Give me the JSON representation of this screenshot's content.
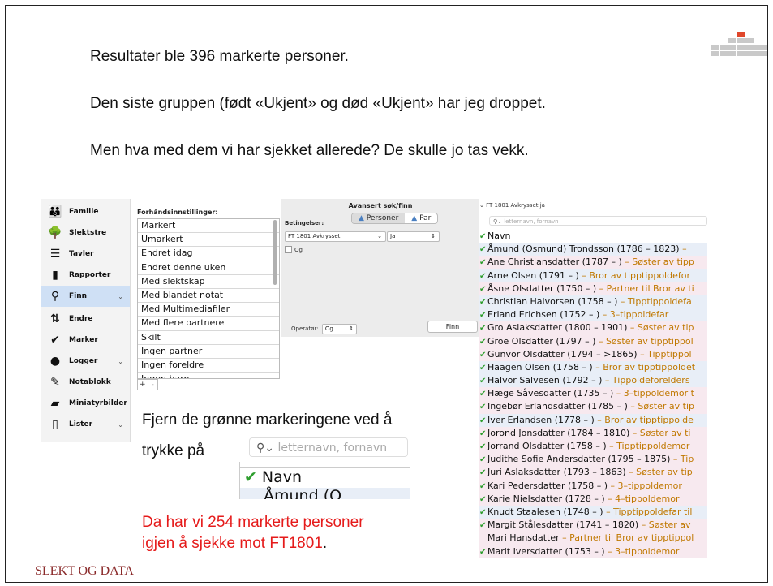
{
  "slide": {
    "line1": "Resultater ble 396 markerte personer.",
    "line2": "Den siste gruppen (født «Ukjent» og død «Ukjent» har jeg droppet.",
    "line3": "Men hva med dem vi har sjekket allerede? De skulle jo tas vekk.",
    "instr1": "Fjern de grønne markeringene ved å",
    "instr2": "trykke på",
    "red1": "Da har vi 254 markerte personer",
    "red2": "igjen å sjekke mot FT1801",
    "red2_dot": ".",
    "footer": "SLEKT OG DATA"
  },
  "colors": {
    "check": "#2e9e2e",
    "relation": "#c07800",
    "red_text": "#e51b1b",
    "logo_accent": "#e0472b",
    "logo_grey": "#c9c9c9"
  },
  "sidebar": {
    "items": [
      {
        "label": "Familie",
        "icon": "family-icon",
        "glyph": "👪"
      },
      {
        "label": "Slektstre",
        "icon": "tree-icon",
        "glyph": "🌳"
      },
      {
        "label": "Tavler",
        "icon": "charts-icon",
        "glyph": "☰"
      },
      {
        "label": "Rapporter",
        "icon": "report-icon",
        "glyph": "▮"
      },
      {
        "label": "Finn",
        "icon": "magnifier-icon",
        "glyph": "⚲"
      },
      {
        "label": "Endre",
        "icon": "edit-sliders-icon",
        "glyph": "⇅"
      },
      {
        "label": "Marker",
        "icon": "checkmark-icon",
        "glyph": "✔"
      },
      {
        "label": "Logger",
        "icon": "logs-icon",
        "glyph": "●"
      },
      {
        "label": "Notablokk",
        "icon": "notepad-icon",
        "glyph": "✎"
      },
      {
        "label": "Miniatyrbilder",
        "icon": "thumbnails-icon",
        "glyph": "▰"
      },
      {
        "label": "Lister",
        "icon": "lists-icon",
        "glyph": "▯"
      }
    ]
  },
  "presets": {
    "label": "Forhåndsinnstillinger:",
    "items": [
      "Markert",
      "Umarkert",
      "Endret idag",
      "Endret denne uken",
      "Med slektskap",
      "Med blandet notat",
      "Med Multimediafiler",
      "Med flere partnere",
      "Skilt",
      "Ingen partner",
      "Ingen foreldre",
      "Ingen barn"
    ],
    "add": "+",
    "remove": "-"
  },
  "advanced": {
    "title": "Avansert søk/finn",
    "tab_persons": "Personer",
    "tab_pairs": "Par",
    "conditions_label": "Betingelser:",
    "condition_field": "FT 1801 Avkrysset",
    "condition_value": "Ja",
    "og_label": "Og",
    "operator_label": "Operatør:",
    "operator_value": "Og",
    "find_button": "Finn"
  },
  "results": {
    "header": "FT 1801 Avkrysset ja",
    "search_placeholder": "letternavn, fornavn",
    "column": "Navn",
    "rows": [
      {
        "name": "Åmund (Osmund) Trondsson (1786 – 1823)",
        "rel": " –",
        "bg": "blue"
      },
      {
        "name": "Ane Christiansdatter (1787 – )",
        "rel": " – Søster av tipp",
        "bg": "pink"
      },
      {
        "name": "Arne Olsen (1791 – )",
        "rel": " – Bror av tipptippoldefor",
        "bg": "blue"
      },
      {
        "name": "Åsne Olsdatter (1750 – )",
        "rel": " – Partner til Bror av ti",
        "bg": "pink"
      },
      {
        "name": "Christian Halvorsen (1758 – )",
        "rel": " – Tipptippoldefa",
        "bg": "blue"
      },
      {
        "name": "Erland Erichsen (1752 – )",
        "rel": " – 3–tippoldefar",
        "bg": "blue"
      },
      {
        "name": "Gro Aslaksdatter (1800 – 1901)",
        "rel": " – Søster av tip",
        "bg": "pink"
      },
      {
        "name": "Groe Olsdatter (1797 – )",
        "rel": " – Søster av tipptippol",
        "bg": "pink"
      },
      {
        "name": "Gunvor Olsdatter (1794 – >1865)",
        "rel": " – Tipptippol",
        "bg": "pink"
      },
      {
        "name": "Haagen Olsen (1758 – )",
        "rel": " – Bror av tipptippoldet",
        "bg": "blue"
      },
      {
        "name": "Halvor Salvesen (1792 – )",
        "rel": " – Tippoldeforelders",
        "bg": "blue"
      },
      {
        "name": "Hæge Såvesdatter (1735 – )",
        "rel": " – 3–tippoldemor t",
        "bg": "pink"
      },
      {
        "name": "Ingebør Erlandsdatter (1785 – )",
        "rel": " – Søster av tip",
        "bg": "pink"
      },
      {
        "name": "Iver Erlandsen (1778 – )",
        "rel": " – Bror av tipptippolde",
        "bg": "blue"
      },
      {
        "name": "Jorond Jonsdatter (1784 – 1810)",
        "rel": " – Søster av ti",
        "bg": "pink"
      },
      {
        "name": "Jorrand Olsdatter (1758 – )",
        "rel": " – Tipptippoldemor",
        "bg": "pink"
      },
      {
        "name": "Judithe Sofie Andersdatter (1795 – 1875)",
        "rel": " – Tip",
        "bg": "pink"
      },
      {
        "name": "Juri Aslaksdatter (1793 – 1863)",
        "rel": " – Søster av tip",
        "bg": "pink"
      },
      {
        "name": "Kari Pedersdatter (1758 – )",
        "rel": " – 3–tippoldemor",
        "bg": "pink"
      },
      {
        "name": "Karie Nielsdatter (1728 – )",
        "rel": " – 4–tippoldemor",
        "bg": "pink"
      },
      {
        "name": "Knudt Staalesen (1748 – )",
        "rel": " – Tipptippoldefar til",
        "bg": "blue"
      },
      {
        "name": "Margit Stålesdatter (1741 – 1820)",
        "rel": " – Søster av",
        "bg": "pink"
      },
      {
        "name": "Mari Hansdatter",
        "rel": " – Partner til Bror av tipptippol",
        "bg": "pink",
        "nocheck": true
      },
      {
        "name": "Marit Iversdatter (1753 – )",
        "rel": " – 3–tippoldemor",
        "bg": "pink"
      }
    ]
  },
  "zoom": {
    "search_placeholder": "letternavn, fornavn",
    "column": "Navn",
    "next_row": "Åmund (O"
  }
}
